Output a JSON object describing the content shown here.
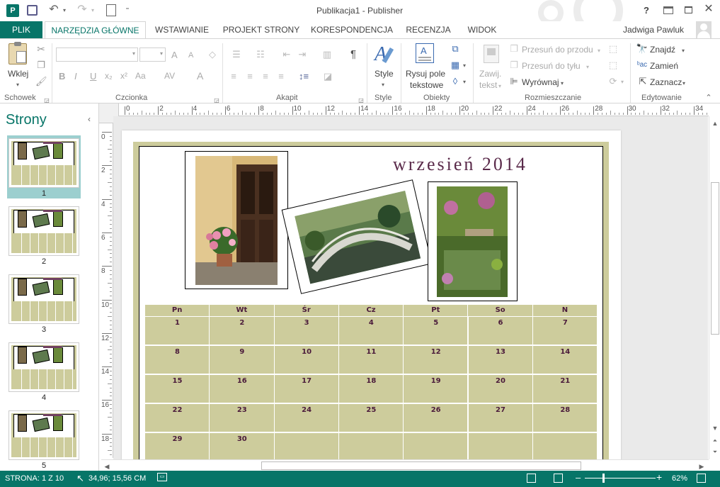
{
  "title_bar": {
    "app_title": "Publikacja1 - Publisher",
    "help": "?",
    "qat_more": "⁼"
  },
  "tabs": [
    {
      "label": "PLIK"
    },
    {
      "label": "NARZĘDZIA GŁÓWNE"
    },
    {
      "label": "WSTAWIANIE"
    },
    {
      "label": "PROJEKT STRONY"
    },
    {
      "label": "KORESPONDENCJA"
    },
    {
      "label": "RECENZJA"
    },
    {
      "label": "WIDOK"
    }
  ],
  "user": {
    "name": "Jadwiga Pawluk"
  },
  "ribbon": {
    "clipboard": {
      "paste": "Wklej",
      "group": "Schowek"
    },
    "font": {
      "group": "Czcionka",
      "bold": "B",
      "italic": "I",
      "underline": "U",
      "subscript": "x₂",
      "superscript": "x²",
      "change_case": "Aa",
      "spacing": "AV",
      "color": "A",
      "grow": "A",
      "shrink": "A"
    },
    "paragraph": {
      "group": "Akapit",
      "pilcrow": "¶"
    },
    "styles": {
      "label": "Style",
      "group": "Style"
    },
    "objects": {
      "draw_textbox": "Rysuj pole",
      "draw_textbox2": "tekstowe",
      "group": "Obiekty"
    },
    "arrange": {
      "wrap": "Zawij.",
      "wrap2": "tekst",
      "bring_forward": "Przesuń do przodu",
      "send_backward": "Przesuń do tyłu",
      "align": "Wyrównaj",
      "group": "Rozmieszczanie"
    },
    "editing": {
      "find": "Znajdź",
      "replace": "Zamień",
      "select": "Zaznacz",
      "group": "Edytowanie"
    }
  },
  "pages_panel": {
    "title": "Strony",
    "pages": [
      {
        "num": "1"
      },
      {
        "num": "2"
      },
      {
        "num": "3"
      },
      {
        "num": "4"
      },
      {
        "num": "5"
      }
    ]
  },
  "ruler": {
    "h_ticks": [
      "0",
      "2",
      "4",
      "6",
      "8",
      "10",
      "12",
      "14",
      "16",
      "18",
      "20",
      "22",
      "24",
      "26",
      "28",
      "30",
      "32",
      "34"
    ],
    "v_ticks": [
      "0",
      "2",
      "4",
      "6",
      "8",
      "10",
      "12",
      "14",
      "16",
      "18"
    ]
  },
  "calendar": {
    "month_title": "wrzesień 2014",
    "days": [
      "Pn",
      "Wt",
      "Śr",
      "Cz",
      "Pt",
      "So",
      "N"
    ],
    "weeks": [
      [
        "1",
        "2",
        "3",
        "4",
        "5",
        "6",
        "7"
      ],
      [
        "8",
        "9",
        "10",
        "11",
        "12",
        "13",
        "14"
      ],
      [
        "15",
        "16",
        "17",
        "18",
        "19",
        "20",
        "21"
      ],
      [
        "22",
        "23",
        "24",
        "25",
        "26",
        "27",
        "28"
      ],
      [
        "29",
        "30",
        "",
        "",
        "",
        "",
        ""
      ]
    ]
  },
  "status_bar": {
    "page": "STRONA: 1 Z 10",
    "position": "34,96; 15,56 CM",
    "zoom": "62%"
  },
  "colors": {
    "accent": "#077568",
    "calendar_fill": "#cdcc9c",
    "title_color": "#5a2a4a"
  }
}
